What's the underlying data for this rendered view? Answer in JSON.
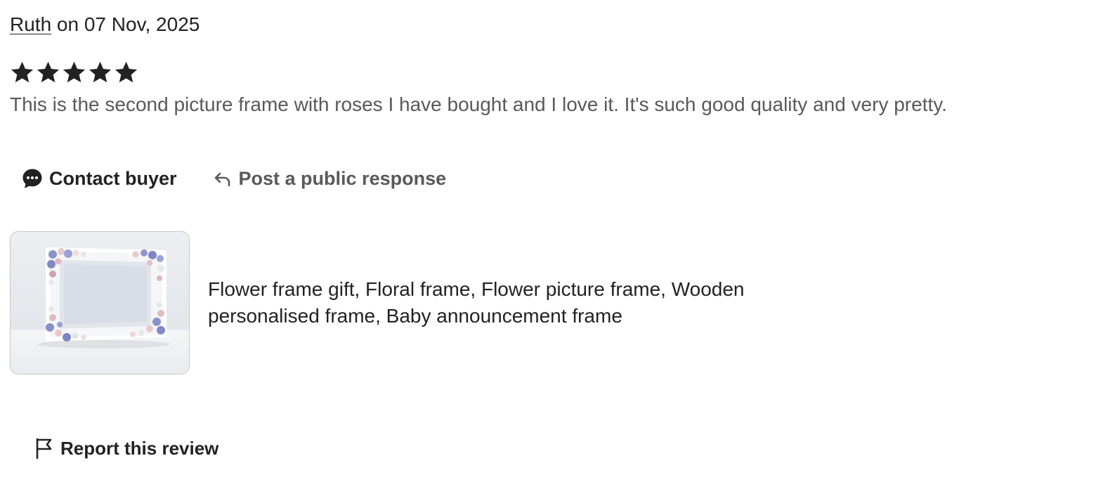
{
  "review": {
    "reviewer_name": "Ruth",
    "date_text": " on 07 Nov, 2025",
    "rating": 5,
    "rating_max": 5,
    "text": "This is the second picture frame with roses I have bought and I love it. It's such good quality and very pretty."
  },
  "actions": {
    "contact_label": "Contact buyer",
    "contact_icon": "chat-bubble-icon",
    "respond_label": "Post a public response",
    "respond_icon": "reply-arrow-icon"
  },
  "listing": {
    "title": "Flower frame gift, Floral frame, Flower picture frame, Wooden personalised frame, Baby announcement frame",
    "image_alt": "White wooden picture frame decorated with roses"
  },
  "report": {
    "label": "Report this review",
    "icon": "flag-icon"
  },
  "colors": {
    "primary_text": "#222222",
    "secondary_text": "#595959",
    "star": "#222222"
  }
}
